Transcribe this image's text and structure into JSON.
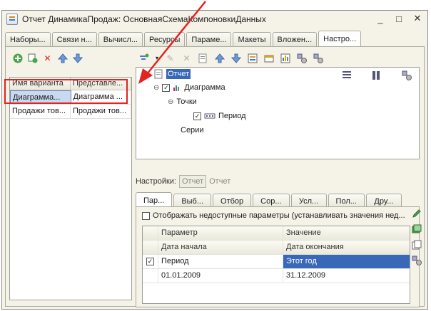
{
  "window": {
    "title": "Отчет ДинамикаПродаж: ОсновнаяСхемаКомпоновкиДанных",
    "buttons": [
      "_",
      "□",
      "✕"
    ]
  },
  "top_tabs": [
    {
      "label": "Наборы..."
    },
    {
      "label": "Связи н..."
    },
    {
      "label": "Вычисл..."
    },
    {
      "label": "Ресурсы"
    },
    {
      "label": "Параме..."
    },
    {
      "label": "Макеты"
    },
    {
      "label": "Вложен..."
    },
    {
      "label": "Настро..."
    }
  ],
  "variants_grid": {
    "headers": [
      "Имя варианта",
      "Представле..."
    ],
    "rows": [
      [
        "Диаграмма...",
        "Диаграмма ..."
      ],
      [
        "Продажи тов...",
        "Продажи тов..."
      ]
    ]
  },
  "tree": {
    "root": "Отчет",
    "diagram": "Диаграмма",
    "points": "Точки",
    "period": "Период",
    "series": "Серии"
  },
  "settings": {
    "label": "Настройки:",
    "btn_report": "Отчет",
    "text_report": "Отчет"
  },
  "bottom_tabs": [
    {
      "label": "Пар..."
    },
    {
      "label": "Выб..."
    },
    {
      "label": "Отбор"
    },
    {
      "label": "Сор..."
    },
    {
      "label": "Усл..."
    },
    {
      "label": "Пол..."
    },
    {
      "label": "Дру..."
    }
  ],
  "params": {
    "show_unavailable": "Отображать недоступные параметры (устанавливать значения нед...",
    "col_param": "Параметр",
    "col_value": "Значение",
    "sub_start": "Дата начала",
    "sub_end": "Дата окончания",
    "row_name": "Период",
    "row_value": "Этот год",
    "date_start": "01.01.2009",
    "date_end": "31.12.2009"
  },
  "colors": {
    "accent": "#3a68b8",
    "annotation": "#e32222"
  }
}
